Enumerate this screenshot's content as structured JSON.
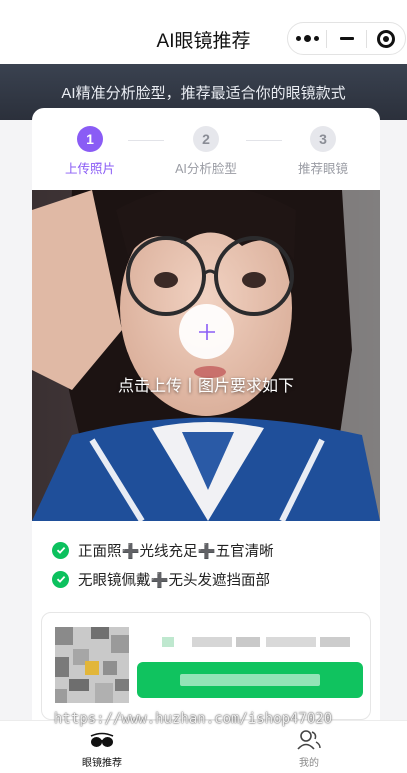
{
  "navbar": {
    "title": "AI眼镜推荐",
    "capsule": {
      "more_icon": "more-dots-icon",
      "minimize_icon": "minimize-icon",
      "close_icon": "target-close-icon"
    }
  },
  "hero": {
    "text": "AI精准分析脸型，推荐最适合你的眼镜款式"
  },
  "steps": [
    {
      "num": "1",
      "label": "上传照片",
      "active": true
    },
    {
      "num": "2",
      "label": "AI分析脸型",
      "active": false
    },
    {
      "num": "3",
      "label": "推荐眼镜",
      "active": false
    }
  ],
  "upload": {
    "icon": "plus-icon",
    "text": "点击上传丨图片要求如下"
  },
  "requirements": [
    {
      "text": "正面照➕光线充足➕五官清晰"
    },
    {
      "text": "无眼镜佩戴➕无头发遮挡面部"
    }
  ],
  "watermark": "https://www.huzhan.com/ishop47020",
  "tabbar": [
    {
      "label": "眼镜推荐",
      "icon": "glasses-icon",
      "active": true
    },
    {
      "label": "我的",
      "icon": "user-icon",
      "active": false
    }
  ],
  "colors": {
    "accent": "#8a5cf5",
    "success": "#0cc15e",
    "button_green": "#10c35f",
    "hero_bg": "#2b303b"
  }
}
